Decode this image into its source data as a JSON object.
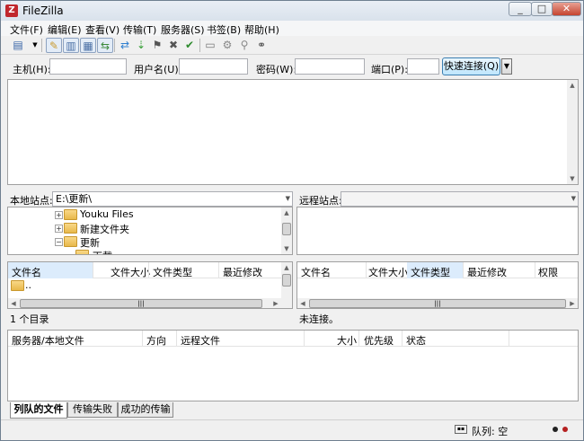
{
  "window": {
    "title": "FileZilla",
    "minimize": "_",
    "maximize": "□",
    "close": "✕"
  },
  "menu": [
    "文件(F)",
    "编辑(E)",
    "查看(V)",
    "传输(T)",
    "服务器(S)",
    "书签(B)",
    "帮助(H)"
  ],
  "quickconnect": {
    "host_label": "主机(H):",
    "user_label": "用户名(U):",
    "pass_label": "密码(W):",
    "port_label": "端口(P):",
    "button": "快速连接(Q)",
    "host_value": "",
    "user_value": "",
    "pass_value": "",
    "port_value": ""
  },
  "local": {
    "label": "本地站点:",
    "path": "E:\\更新\\",
    "tree": [
      "Youku Files",
      "新建文件夹",
      "更新",
      "下载"
    ],
    "columns": [
      "文件名",
      "文件大小",
      "文件类型",
      "最近修改"
    ],
    "files": [
      ".."
    ],
    "status": "1 个目录"
  },
  "remote": {
    "label": "远程站点:",
    "path": "",
    "columns": [
      "文件名",
      "文件大小",
      "文件类型",
      "最近修改",
      "权限"
    ],
    "status": "未连接。"
  },
  "queue": {
    "columns": [
      "服务器/本地文件",
      "方向",
      "远程文件",
      "大小",
      "优先级",
      "状态"
    ],
    "tabs": [
      "列队的文件",
      "传输失败",
      "成功的传输"
    ]
  },
  "statusbar": {
    "queue": "队列: 空"
  },
  "icons": [
    "site-manager-icon",
    "message-log-icon",
    "local-tree-icon",
    "remote-tree-icon",
    "queue-icon",
    "refresh-icon",
    "process-queue-icon",
    "cancel-icon",
    "disconnect-icon",
    "reconnect-icon",
    "filter-icon",
    "compare-icon",
    "sync-browse-icon",
    "search-icon"
  ]
}
